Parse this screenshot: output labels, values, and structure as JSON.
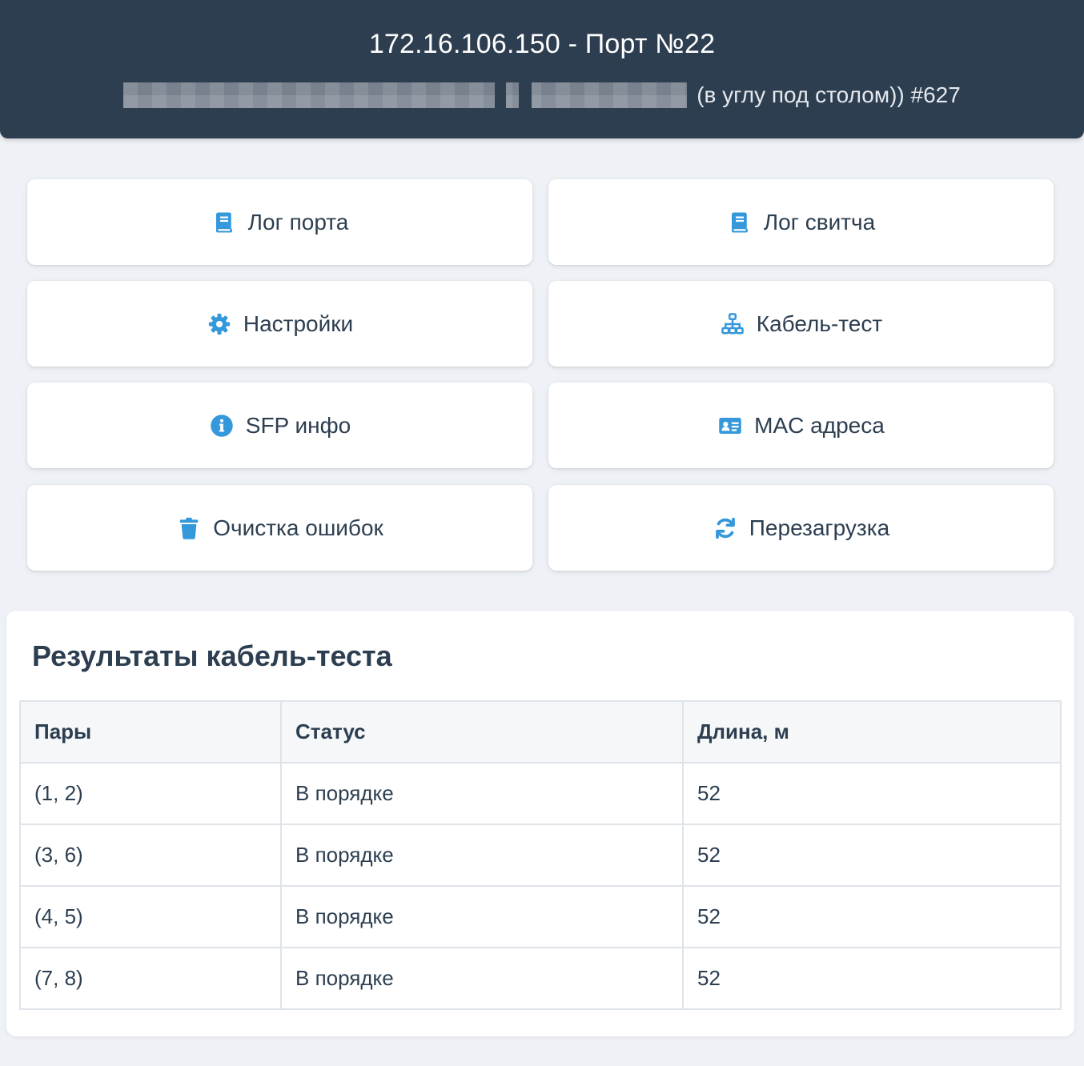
{
  "header": {
    "title": "172.16.106.150 - Порт №22",
    "subtitle": "(в углу под столом)) #627"
  },
  "buttons": {
    "port_log": "Лог порта",
    "switch_log": "Лог свитча",
    "settings": "Настройки",
    "cable_test": "Кабель-тест",
    "sfp_info": "SFP инфо",
    "mac_addresses": "MAC адреса",
    "clear_errors": "Очистка ошибок",
    "reboot": "Перезагрузка"
  },
  "icons": {
    "port_log": "book-icon",
    "switch_log": "book-icon",
    "settings": "gear-icon",
    "cable_test": "network-icon",
    "sfp_info": "info-icon",
    "mac_addresses": "id-card-icon",
    "clear_errors": "trash-icon",
    "reboot": "sync-icon"
  },
  "colors": {
    "header_bg": "#2d3e50",
    "accent": "#3498db",
    "page_bg": "#eef1f5"
  },
  "results": {
    "title": "Результаты кабель-теста",
    "columns": [
      "Пары",
      "Статус",
      "Длина, м"
    ],
    "rows": [
      [
        "(1, 2)",
        "В порядке",
        "52"
      ],
      [
        "(3, 6)",
        "В порядке",
        "52"
      ],
      [
        "(4, 5)",
        "В порядке",
        "52"
      ],
      [
        "(7, 8)",
        "В порядке",
        "52"
      ]
    ]
  }
}
